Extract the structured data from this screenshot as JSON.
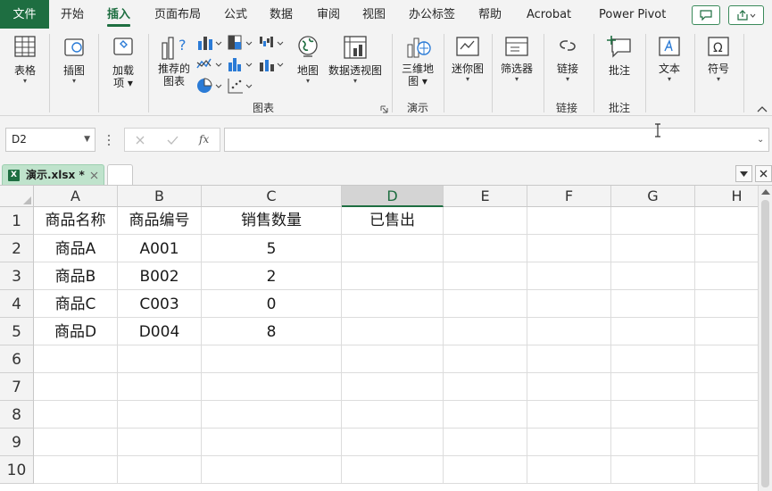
{
  "menu": {
    "file": "文件",
    "tabs": [
      "开始",
      "插入",
      "页面布局",
      "公式",
      "数据",
      "审阅",
      "视图",
      "办公标签",
      "帮助",
      "Acrobat",
      "Power Pivot"
    ],
    "active_tab": "插入"
  },
  "ribbon": {
    "table": "表格",
    "illustrations": "插图",
    "addins_line1": "加载",
    "addins_line2": "项",
    "recommended_charts_line1": "推荐的",
    "recommended_charts_line2": "图表",
    "map": "地图",
    "pivot_chart": "数据透视图",
    "map3d_line1": "三维地",
    "map3d_line2": "图",
    "sparklines": "迷你图",
    "slicer": "筛选器",
    "link": "链接",
    "comment": "批注",
    "text": "文本",
    "symbol": "符号",
    "group_charts": "图表",
    "group_tours": "演示",
    "group_links": "链接",
    "group_comments": "批注"
  },
  "formula_bar": {
    "name_box": "D2",
    "fx": "fx",
    "formula": ""
  },
  "workbook": {
    "tab_name": "演示.xlsx *",
    "excel_badge": "X"
  },
  "sheet": {
    "columns": [
      "A",
      "B",
      "C",
      "D",
      "E",
      "F",
      "G",
      "H"
    ],
    "rows": [
      "1",
      "2",
      "3",
      "4",
      "5",
      "6",
      "7",
      "8",
      "9",
      "10"
    ],
    "selected_cell": "D2",
    "cells": [
      [
        "商品名称",
        "商品编号",
        "销售数量",
        "已售出"
      ],
      [
        "商品A",
        "A001",
        "5",
        ""
      ],
      [
        "商品B",
        "B002",
        "2",
        ""
      ],
      [
        "商品C",
        "C003",
        "0",
        ""
      ],
      [
        "商品D",
        "D004",
        "8",
        ""
      ]
    ]
  },
  "colors": {
    "accent": "#1e6e41",
    "tab_active_bg": "#bfe3cc",
    "ribbon_bg": "#f3f3f3"
  }
}
